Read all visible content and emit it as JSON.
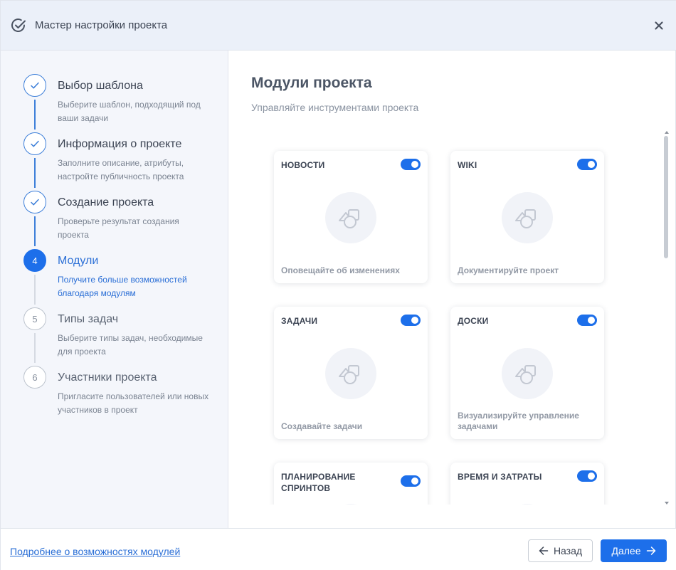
{
  "header": {
    "title": "Мастер настройки проекта",
    "app_icon": "check-circle-icon",
    "close_icon": "close-icon"
  },
  "steps": [
    {
      "number": "1",
      "title": "Выбор шаблона",
      "description": "Выберите шаблон, подходящий под ваши задачи",
      "state": "done"
    },
    {
      "number": "2",
      "title": "Информация о проекте",
      "description": "Заполните описание, атрибуты, настройте публичность проекта",
      "state": "done"
    },
    {
      "number": "3",
      "title": "Создание проекта",
      "description": "Проверьте результат создания проекта",
      "state": "done"
    },
    {
      "number": "4",
      "title": "Модули",
      "description": "Получите больше возможностей благодаря модулям",
      "state": "active"
    },
    {
      "number": "5",
      "title": "Типы задач",
      "description": "Выберите типы задач, необходимые для проекта",
      "state": "pending"
    },
    {
      "number": "6",
      "title": "Участники проекта",
      "description": "Пригласите пользователей или новых участников в проект",
      "state": "pending"
    }
  ],
  "main": {
    "title": "Модули проекта",
    "subtitle": "Управляйте инструментами проекта"
  },
  "modules": [
    {
      "title": "НОВОСТИ",
      "description": "Оповещайте об изменениях",
      "enabled": true
    },
    {
      "title": "WIKI",
      "description": "Документируйте проект",
      "enabled": true
    },
    {
      "title": "ЗАДАЧИ",
      "description": "Создавайте задачи",
      "enabled": true
    },
    {
      "title": "ДОСКИ",
      "description": "Визуализируйте управление задачами",
      "enabled": true
    },
    {
      "title": "ПЛАНИРОВАНИЕ СПРИНТОВ",
      "description": "",
      "enabled": true
    },
    {
      "title": "ВРЕМЯ И ЗАТРАТЫ",
      "description": "",
      "enabled": true
    }
  ],
  "footer": {
    "link": "Подробнее о возможностях модулей",
    "back_label": "Назад",
    "next_label": "Далее"
  },
  "colors": {
    "accent": "#1d6fea",
    "header_bg": "#ebf0f9",
    "sidebar_bg": "#f4f6fb"
  }
}
